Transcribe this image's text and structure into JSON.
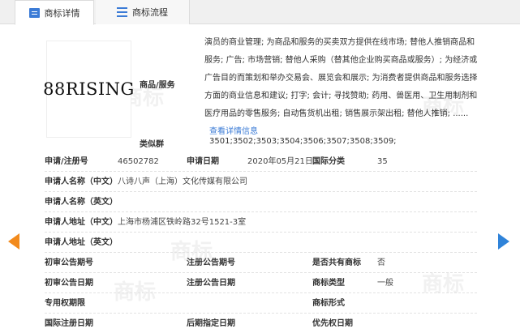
{
  "tabs": [
    {
      "label": "商标详情"
    },
    {
      "label": "商标流程"
    }
  ],
  "watermark": "商标",
  "logo": {
    "text": "88RISING"
  },
  "goods": {
    "label": "商品/服务",
    "text": "演员的商业管理; 为商品和服务的买卖双方提供在线市场; 替他人推销商品和服务; 广告; 市场营销; 替他人采购（替其他企业购买商品或服务）; 为经济或广告目的而策划和举办交易会、展览会和展示; 为消费者提供商品和服务选择方面的商业信息和建议; 打字; 会计; 寻找赞助; 药用、兽医用、卫生用制剂和医疗用品的零售服务; 自动售货机出租; 销售展示架出租; 替他人推销; ......",
    "more_link": "查看详情信息"
  },
  "classes": {
    "label": "类似群",
    "value": "3501;3502;3503;3504;3506;3507;3508;3509;"
  },
  "fields": {
    "reg_no_label": "申请/注册号",
    "reg_no": "46502782",
    "apply_date_label": "申请日期",
    "apply_date": "2020年05月21日",
    "intl_class_label": "国际分类",
    "intl_class": "35",
    "applicant_cn_label": "申请人名称（中文）",
    "applicant_cn": "八诗八声（上海）文化传媒有限公司",
    "applicant_en_label": "申请人名称（英文）",
    "applicant_en": "",
    "address_cn_label": "申请人地址（中文）",
    "address_cn": "上海市杨浦区铁岭路32号1521-3室",
    "address_en_label": "申请人地址（英文）",
    "address_en": "",
    "prelim_no_label": "初审公告期号",
    "reg_notice_no_label": "注册公告期号",
    "shared_label": "是否共有商标",
    "shared": "否",
    "prelim_date_label": "初审公告日期",
    "reg_notice_date_label": "注册公告日期",
    "mark_type_label": "商标类型",
    "mark_type": "一般",
    "exclusive_label": "专用权期限",
    "mark_form_label": "商标形式",
    "intl_reg_date_label": "国际注册日期",
    "later_date_label": "后期指定日期",
    "priority_date_label": "优先权日期"
  }
}
